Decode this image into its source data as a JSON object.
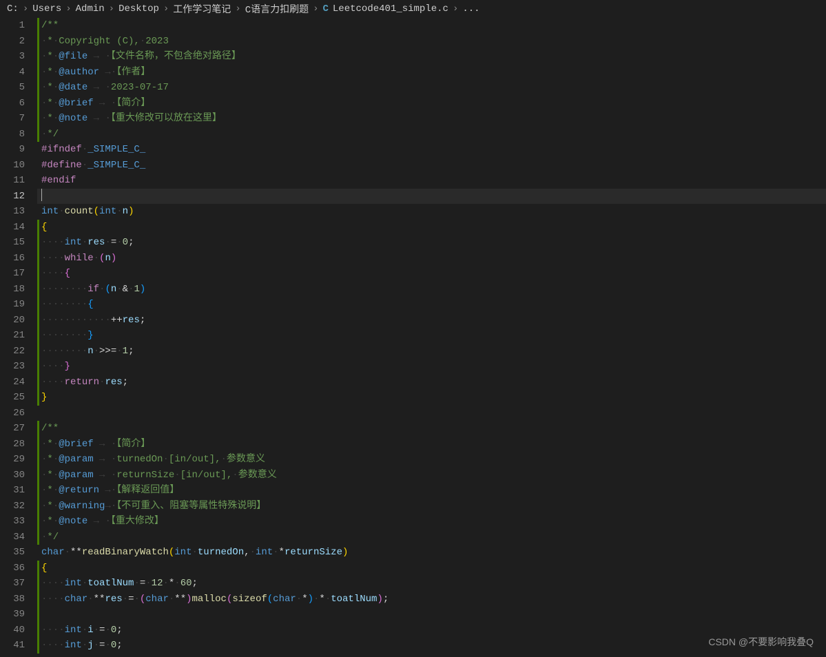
{
  "breadcrumb": {
    "segments": [
      "C:",
      "Users",
      "Admin",
      "Desktop",
      "工作学习笔记",
      "C语言力扣刷题"
    ],
    "file_icon": "C",
    "filename": "Leetcode401_simple.c",
    "more": "..."
  },
  "lines": [
    {
      "n": 1,
      "html": "<span class='hl-comment'>/**</span>"
    },
    {
      "n": 2,
      "html": "<span class='ws'>·</span><span class='hl-comment'>*</span><span class='ws'>·</span><span class='hl-comment'>Copyright (C),</span><span class='ws'>·</span><span class='hl-comment'>2023</span>"
    },
    {
      "n": 3,
      "html": "<span class='ws'>·</span><span class='hl-comment'>*</span><span class='ws'>·</span><span class='hl-doctag'>@file</span><span class='ws'> → ·</span><span class='hl-comment'>【文件名称，不包含绝对路径】</span>"
    },
    {
      "n": 4,
      "html": "<span class='ws'>·</span><span class='hl-comment'>*</span><span class='ws'>·</span><span class='hl-doctag'>@author</span><span class='ws'> →·</span><span class='hl-comment'>【作者】</span>"
    },
    {
      "n": 5,
      "html": "<span class='ws'>·</span><span class='hl-comment'>*</span><span class='ws'>·</span><span class='hl-doctag'>@date</span><span class='ws'> → ·</span><span class='hl-comment'>2023-07-17</span>"
    },
    {
      "n": 6,
      "html": "<span class='ws'>·</span><span class='hl-comment'>*</span><span class='ws'>·</span><span class='hl-doctag'>@brief</span><span class='ws'> → ·</span><span class='hl-comment'>【简介】</span>"
    },
    {
      "n": 7,
      "html": "<span class='ws'>·</span><span class='hl-comment'>*</span><span class='ws'>·</span><span class='hl-doctag'>@note</span><span class='ws'> → ·</span><span class='hl-comment'>【重大修改可以放在这里】</span>"
    },
    {
      "n": 8,
      "html": "<span class='ws'>·</span><span class='hl-comment'>*/</span>"
    },
    {
      "n": 9,
      "html": "<span class='hl-keyword'>#ifndef</span><span class='ws'>·</span><span class='hl-macro'>_SIMPLE_C_</span>"
    },
    {
      "n": 10,
      "html": "<span class='hl-keyword'>#define</span><span class='ws'>·</span><span class='hl-macro'>_SIMPLE_C_</span>"
    },
    {
      "n": 11,
      "html": "<span class='hl-keyword'>#endif</span>"
    },
    {
      "n": 12,
      "html": "<span class='cursor'></span>",
      "active": true
    },
    {
      "n": 13,
      "html": "<span class='hl-type'>int</span><span class='ws'>·</span><span class='hl-func'>count</span><span class='hl-brace'>(</span><span class='hl-type'>int</span><span class='ws'>·</span><span class='hl-id'>n</span><span class='hl-brace'>)</span>"
    },
    {
      "n": 14,
      "html": "<span class='hl-brace'>{</span>"
    },
    {
      "n": 15,
      "html": "<span class='ws'>····</span><span class='hl-type'>int</span><span class='ws'>·</span><span class='hl-id'>res</span><span class='ws'>·</span><span class='hl-op'>=</span><span class='ws'>·</span><span class='hl-num'>0</span><span class='hl-punc'>;</span>"
    },
    {
      "n": 16,
      "html": "<span class='ws'>····</span><span class='hl-keyword'>while</span><span class='ws'>·</span><span class='hl-brace2'>(</span><span class='hl-id'>n</span><span class='hl-brace2'>)</span>"
    },
    {
      "n": 17,
      "html": "<span class='ws'>····</span><span class='hl-brace2'>{</span>"
    },
    {
      "n": 18,
      "html": "<span class='ws'>········</span><span class='hl-keyword'>if</span><span class='ws'>·</span><span class='hl-brace3'>(</span><span class='hl-id'>n</span><span class='ws'>·</span><span class='hl-op'>&amp;</span><span class='ws'>·</span><span class='hl-num'>1</span><span class='hl-brace3'>)</span>"
    },
    {
      "n": 19,
      "html": "<span class='ws'>········</span><span class='hl-brace3'>{</span>"
    },
    {
      "n": 20,
      "html": "<span class='ws'>············</span><span class='hl-op'>++</span><span class='hl-id'>res</span><span class='hl-punc'>;</span>"
    },
    {
      "n": 21,
      "html": "<span class='ws'>········</span><span class='hl-brace3'>}</span>"
    },
    {
      "n": 22,
      "html": "<span class='ws'>········</span><span class='hl-id'>n</span><span class='ws'>·</span><span class='hl-op'>&gt;&gt;=</span><span class='ws'>·</span><span class='hl-num'>1</span><span class='hl-punc'>;</span>"
    },
    {
      "n": 23,
      "html": "<span class='ws'>····</span><span class='hl-brace2'>}</span>"
    },
    {
      "n": 24,
      "html": "<span class='ws'>····</span><span class='hl-keyword'>return</span><span class='ws'>·</span><span class='hl-id'>res</span><span class='hl-punc'>;</span>"
    },
    {
      "n": 25,
      "html": "<span class='hl-brace'>}</span>"
    },
    {
      "n": 26,
      "html": ""
    },
    {
      "n": 27,
      "html": "<span class='hl-comment'>/**</span>"
    },
    {
      "n": 28,
      "html": "<span class='ws'>·</span><span class='hl-comment'>*</span><span class='ws'>·</span><span class='hl-doctag'>@brief</span><span class='ws'> → ·</span><span class='hl-comment'>【简介】</span>"
    },
    {
      "n": 29,
      "html": "<span class='ws'>·</span><span class='hl-comment'>*</span><span class='ws'>·</span><span class='hl-doctag'>@param</span><span class='ws'> → ·</span><span class='hl-comment'>turnedOn</span><span class='ws'>·</span><span class='hl-comment'>[in/out],</span><span class='ws'>·</span><span class='hl-comment'>参数意义</span>"
    },
    {
      "n": 30,
      "html": "<span class='ws'>·</span><span class='hl-comment'>*</span><span class='ws'>·</span><span class='hl-doctag'>@param</span><span class='ws'> → ·</span><span class='hl-comment'>returnSize</span><span class='ws'>·</span><span class='hl-comment'>[in/out],</span><span class='ws'>·</span><span class='hl-comment'>参数意义</span>"
    },
    {
      "n": 31,
      "html": "<span class='ws'>·</span><span class='hl-comment'>*</span><span class='ws'>·</span><span class='hl-doctag'>@return</span><span class='ws'> →·</span><span class='hl-comment'>【解释返回值】</span>"
    },
    {
      "n": 32,
      "html": "<span class='ws'>·</span><span class='hl-comment'>*</span><span class='ws'>·</span><span class='hl-doctag'>@warning</span><span class='ws'>→·</span><span class='hl-comment'>【不可重入、阻塞等属性特殊说明】</span>"
    },
    {
      "n": 33,
      "html": "<span class='ws'>·</span><span class='hl-comment'>*</span><span class='ws'>·</span><span class='hl-doctag'>@note</span><span class='ws'> → ·</span><span class='hl-comment'>【重大修改】</span>"
    },
    {
      "n": 34,
      "html": "<span class='ws'>·</span><span class='hl-comment'>*/</span>"
    },
    {
      "n": 35,
      "html": "<span class='hl-type'>char</span><span class='ws'>·</span><span class='hl-op'>**</span><span class='hl-func'>readBinaryWatch</span><span class='hl-brace'>(</span><span class='hl-type'>int</span><span class='ws'>·</span><span class='hl-id'>turnedOn</span><span class='hl-punc'>,</span><span class='ws'>·</span><span class='hl-type'>int</span><span class='ws'>·</span><span class='hl-op'>*</span><span class='hl-id'>returnSize</span><span class='hl-brace'>)</span>"
    },
    {
      "n": 36,
      "html": "<span class='hl-brace'>{</span>"
    },
    {
      "n": 37,
      "html": "<span class='ws'>····</span><span class='hl-type'>int</span><span class='ws'>·</span><span class='hl-id'>toatlNum</span><span class='ws'>·</span><span class='hl-op'>=</span><span class='ws'>·</span><span class='hl-num'>12</span><span class='ws'>·</span><span class='hl-op'>*</span><span class='ws'>·</span><span class='hl-num'>60</span><span class='hl-punc'>;</span>"
    },
    {
      "n": 38,
      "html": "<span class='ws'>····</span><span class='hl-type'>char</span><span class='ws'>·</span><span class='hl-op'>**</span><span class='hl-id'>res</span><span class='ws'>·</span><span class='hl-op'>=</span><span class='ws'>·</span><span class='hl-brace2'>(</span><span class='hl-type'>char</span><span class='ws'>·</span><span class='hl-op'>**</span><span class='hl-brace2'>)</span><span class='hl-func'>malloc</span><span class='hl-brace2'>(</span><span class='hl-func'>sizeof</span><span class='hl-brace3'>(</span><span class='hl-type'>char</span><span class='ws'>·</span><span class='hl-op'>*</span><span class='hl-brace3'>)</span><span class='ws'>·</span><span class='hl-op'>*</span><span class='ws'>·</span><span class='hl-id'>toatlNum</span><span class='hl-brace2'>)</span><span class='hl-punc'>;</span>"
    },
    {
      "n": 39,
      "html": ""
    },
    {
      "n": 40,
      "html": "<span class='ws'>····</span><span class='hl-type'>int</span><span class='ws'>·</span><span class='hl-id'>i</span><span class='ws'>·</span><span class='hl-op'>=</span><span class='ws'>·</span><span class='hl-num'>0</span><span class='hl-punc'>;</span>"
    },
    {
      "n": 41,
      "html": "<span class='ws'>····</span><span class='hl-type'>int</span><span class='ws'>·</span><span class='hl-id'>j</span><span class='ws'>·</span><span class='hl-op'>=</span><span class='ws'>·</span><span class='hl-num'>0</span><span class='hl-punc'>;</span>"
    }
  ],
  "green_bar_ranges": [
    [
      1,
      8
    ],
    [
      14,
      25
    ],
    [
      27,
      34
    ],
    [
      36,
      41
    ]
  ],
  "watermark": "CSDN @不要影响我叠Q"
}
